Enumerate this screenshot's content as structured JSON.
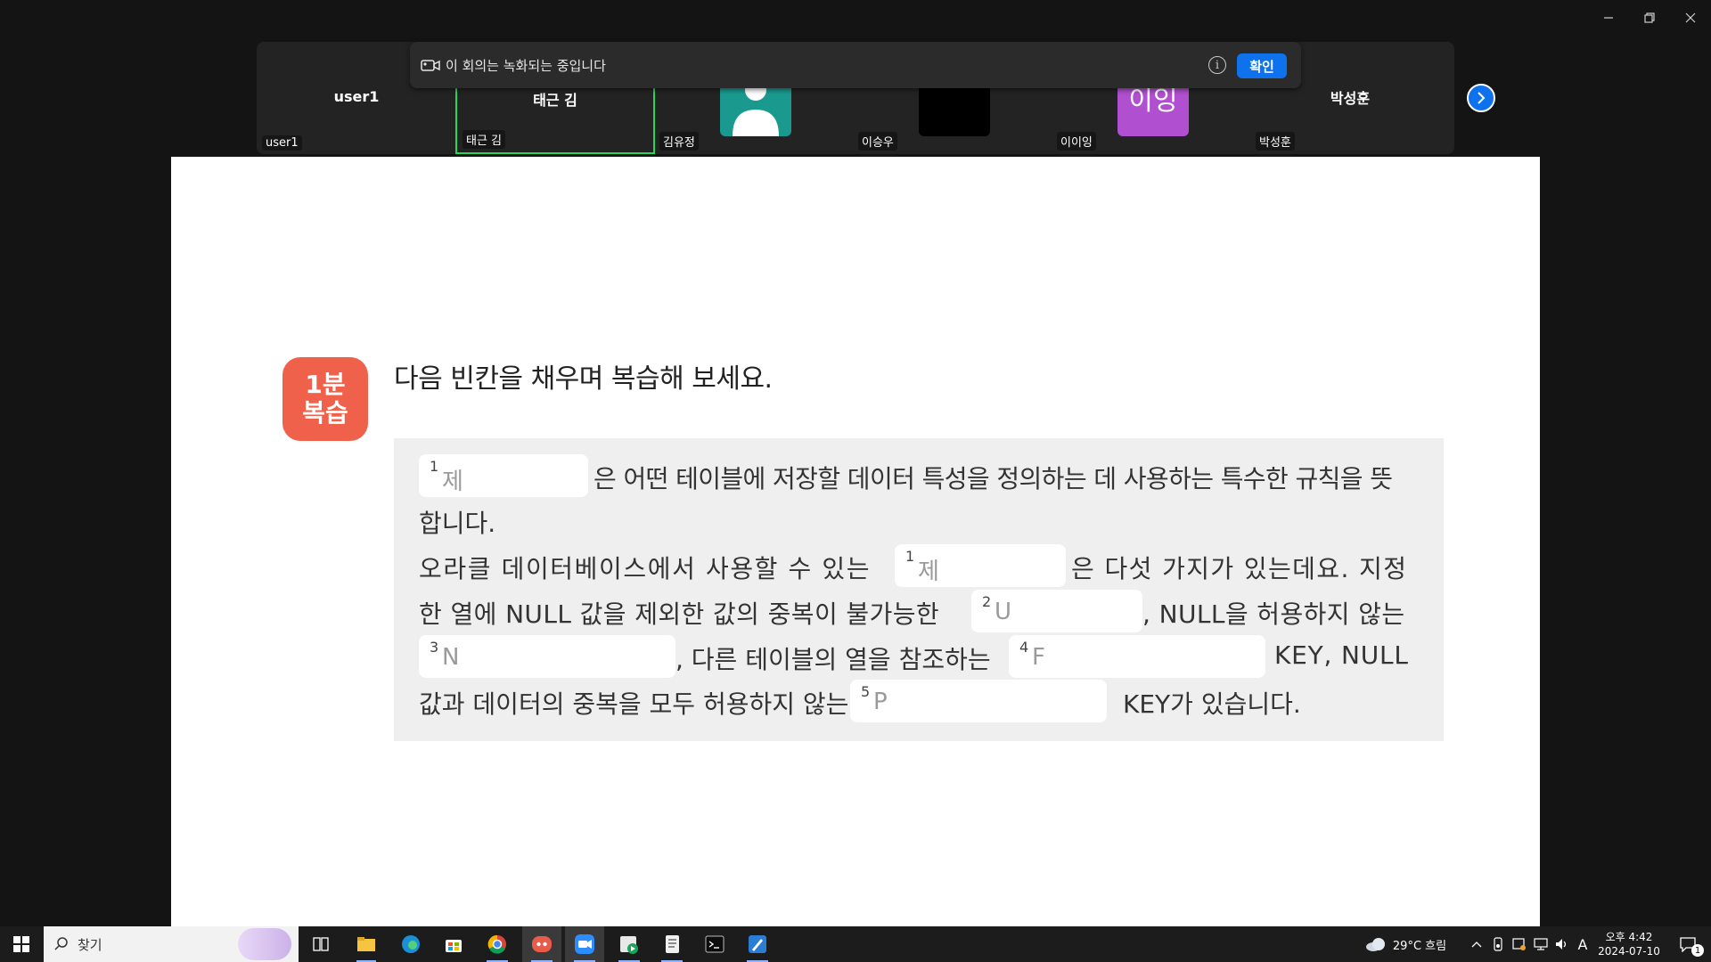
{
  "window": {
    "controls": [
      "minimize",
      "restore",
      "close"
    ]
  },
  "participants": [
    {
      "center_name": "user1",
      "label": "user1",
      "type": "name"
    },
    {
      "center_name": "태근 김",
      "label": "태근 김",
      "type": "name",
      "active": true
    },
    {
      "center_name": "",
      "label": "김유정",
      "type": "avatar-person"
    },
    {
      "center_name": "",
      "label": "이승우",
      "type": "video-black"
    },
    {
      "center_name": "",
      "label": "이이잉",
      "type": "avatar-text",
      "avatar_text": "이잉"
    },
    {
      "center_name": "박성훈",
      "label": "박성훈",
      "type": "name"
    }
  ],
  "banner": {
    "text": "이 회의는 녹화되는 중입니다",
    "info_glyph": "i",
    "ok_label": "확인"
  },
  "slide": {
    "badge_line1": "1분",
    "badge_line2": "복습",
    "title": "다음 빈칸을 채우며 복습해 보세요.",
    "line1_after": "은 어떤 테이블에 저장할 데이터 특성을 정의하는 데 사용하는 특수한 규칙을 뜻",
    "line2": "합니다.",
    "line3_before": "오라클 데이터베이스에서 사용할 수 있는",
    "line3_after": "은 다섯 가지가 있는데요. 지정",
    "line4_before": "한 열에 NULL 값을 제외한 값의 중복이 불가능한",
    "line4_after": ", NULL을 허용하지 않는",
    "line5_mid": ", 다른 테이블의 열을 참조하는",
    "line5_after": "KEY, NULL",
    "line6_before": "값과 데이터의 중복을 모두 허용하지 않는",
    "line6_after": "KEY가 있습니다.",
    "blanks": [
      {
        "num": "1",
        "hint": "제"
      },
      {
        "num": "1",
        "hint": "제"
      },
      {
        "num": "2",
        "hint": "U"
      },
      {
        "num": "3",
        "hint": "N"
      },
      {
        "num": "4",
        "hint": "F"
      },
      {
        "num": "5",
        "hint": "P"
      }
    ]
  },
  "taskbar": {
    "search_placeholder": "찾기",
    "weather": "29°C 흐림",
    "time": "오후 4:42",
    "date": "2024-07-10",
    "ime": "A",
    "notification_count": "1",
    "apps": [
      "task-view",
      "file-explorer",
      "edge",
      "store",
      "chrome",
      "discord",
      "zoom",
      "media-app",
      "notes-app",
      "terminal",
      "paint-app"
    ]
  },
  "colors": {
    "accent": "#0e72ed",
    "active_speaker": "#23d959",
    "badge": "#f0614b",
    "avatar_teal": "#1a9a8f",
    "avatar_purple": "#b04fcf"
  }
}
